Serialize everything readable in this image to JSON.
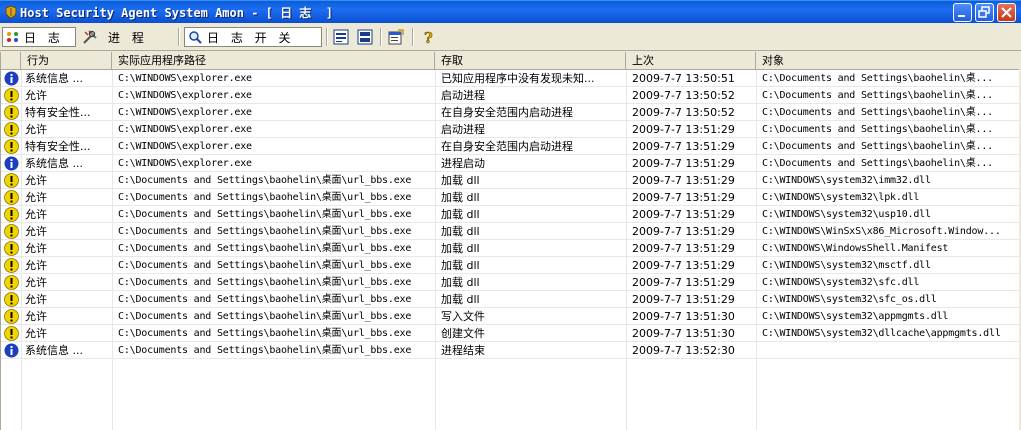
{
  "window": {
    "title": "Host Security Agent System Amon - [ 日 志  ]",
    "controls": {
      "minimize_icon": "minimize-icon",
      "restore_icon": "restore-icon",
      "close_icon": "close-icon"
    }
  },
  "toolbar": {
    "log_label": "日 志",
    "process_label": "进 程",
    "log_switch_label": "日 志 开 关",
    "icons": [
      "dots-icon",
      "tools-icon",
      "search-icon",
      "collapse-icon",
      "expand-icon",
      "properties-icon",
      "help-icon"
    ]
  },
  "table": {
    "headers": [
      "行为",
      "实际应用程序路径",
      "存取",
      "上次",
      "对象"
    ],
    "rows": [
      {
        "icon": "info",
        "action": "系统信息  ...",
        "path": "C:\\WINDOWS\\explorer.exe",
        "access": "已知应用程序中没有发现未知...",
        "time": "2009-7-7 13:50:51",
        "object": "C:\\Documents and Settings\\baohelin\\桌..."
      },
      {
        "icon": "warn",
        "action": "允许",
        "path": "C:\\WINDOWS\\explorer.exe",
        "access": "启动进程",
        "time": "2009-7-7 13:50:52",
        "object": "C:\\Documents and Settings\\baohelin\\桌..."
      },
      {
        "icon": "warn",
        "action": "特有安全性...",
        "path": "C:\\WINDOWS\\explorer.exe",
        "access": "在自身安全范围内启动进程",
        "time": "2009-7-7 13:50:52",
        "object": "C:\\Documents and Settings\\baohelin\\桌..."
      },
      {
        "icon": "warn",
        "action": "允许",
        "path": "C:\\WINDOWS\\explorer.exe",
        "access": "启动进程",
        "time": "2009-7-7 13:51:29",
        "object": "C:\\Documents and Settings\\baohelin\\桌..."
      },
      {
        "icon": "warn",
        "action": "特有安全性...",
        "path": "C:\\WINDOWS\\explorer.exe",
        "access": "在自身安全范围内启动进程",
        "time": "2009-7-7 13:51:29",
        "object": "C:\\Documents and Settings\\baohelin\\桌..."
      },
      {
        "icon": "info",
        "action": "系统信息  ...",
        "path": "C:\\WINDOWS\\explorer.exe",
        "access": "进程启动",
        "time": "2009-7-7 13:51:29",
        "object": "C:\\Documents and Settings\\baohelin\\桌..."
      },
      {
        "icon": "warn",
        "action": "允许",
        "path": "C:\\Documents and Settings\\baohelin\\桌面\\url_bbs.exe",
        "access": "加载 dll",
        "time": "2009-7-7 13:51:29",
        "object": "C:\\WINDOWS\\system32\\imm32.dll"
      },
      {
        "icon": "warn",
        "action": "允许",
        "path": "C:\\Documents and Settings\\baohelin\\桌面\\url_bbs.exe",
        "access": "加载 dll",
        "time": "2009-7-7 13:51:29",
        "object": "C:\\WINDOWS\\system32\\lpk.dll"
      },
      {
        "icon": "warn",
        "action": "允许",
        "path": "C:\\Documents and Settings\\baohelin\\桌面\\url_bbs.exe",
        "access": "加载 dll",
        "time": "2009-7-7 13:51:29",
        "object": "C:\\WINDOWS\\system32\\usp10.dll"
      },
      {
        "icon": "warn",
        "action": "允许",
        "path": "C:\\Documents and Settings\\baohelin\\桌面\\url_bbs.exe",
        "access": "加载 dll",
        "time": "2009-7-7 13:51:29",
        "object": "C:\\WINDOWS\\WinSxS\\x86_Microsoft.Window..."
      },
      {
        "icon": "warn",
        "action": "允许",
        "path": "C:\\Documents and Settings\\baohelin\\桌面\\url_bbs.exe",
        "access": "加载 dll",
        "time": "2009-7-7 13:51:29",
        "object": "C:\\WINDOWS\\WindowsShell.Manifest"
      },
      {
        "icon": "warn",
        "action": "允许",
        "path": "C:\\Documents and Settings\\baohelin\\桌面\\url_bbs.exe",
        "access": "加载 dll",
        "time": "2009-7-7 13:51:29",
        "object": "C:\\WINDOWS\\system32\\msctf.dll"
      },
      {
        "icon": "warn",
        "action": "允许",
        "path": "C:\\Documents and Settings\\baohelin\\桌面\\url_bbs.exe",
        "access": "加载 dll",
        "time": "2009-7-7 13:51:29",
        "object": "C:\\WINDOWS\\system32\\sfc.dll"
      },
      {
        "icon": "warn",
        "action": "允许",
        "path": "C:\\Documents and Settings\\baohelin\\桌面\\url_bbs.exe",
        "access": "加载 dll",
        "time": "2009-7-7 13:51:29",
        "object": "C:\\WINDOWS\\system32\\sfc_os.dll"
      },
      {
        "icon": "warn",
        "action": "允许",
        "path": "C:\\Documents and Settings\\baohelin\\桌面\\url_bbs.exe",
        "access": "写入文件",
        "time": "2009-7-7 13:51:30",
        "object": "C:\\WINDOWS\\system32\\appmgmts.dll"
      },
      {
        "icon": "warn",
        "action": "允许",
        "path": "C:\\Documents and Settings\\baohelin\\桌面\\url_bbs.exe",
        "access": "创建文件",
        "time": "2009-7-7 13:51:30",
        "object": "C:\\WINDOWS\\system32\\dllcache\\appmgmts.dll"
      },
      {
        "icon": "info",
        "action": "系统信息  ...",
        "path": "C:\\Documents and Settings\\baohelin\\桌面\\url_bbs.exe",
        "access": "进程结束",
        "time": "2009-7-7 13:52:30",
        "object": ""
      }
    ]
  },
  "colors": {
    "info": "#1c3fbf",
    "warn": "#f2d400",
    "titlebar": "#0a5fd8"
  }
}
